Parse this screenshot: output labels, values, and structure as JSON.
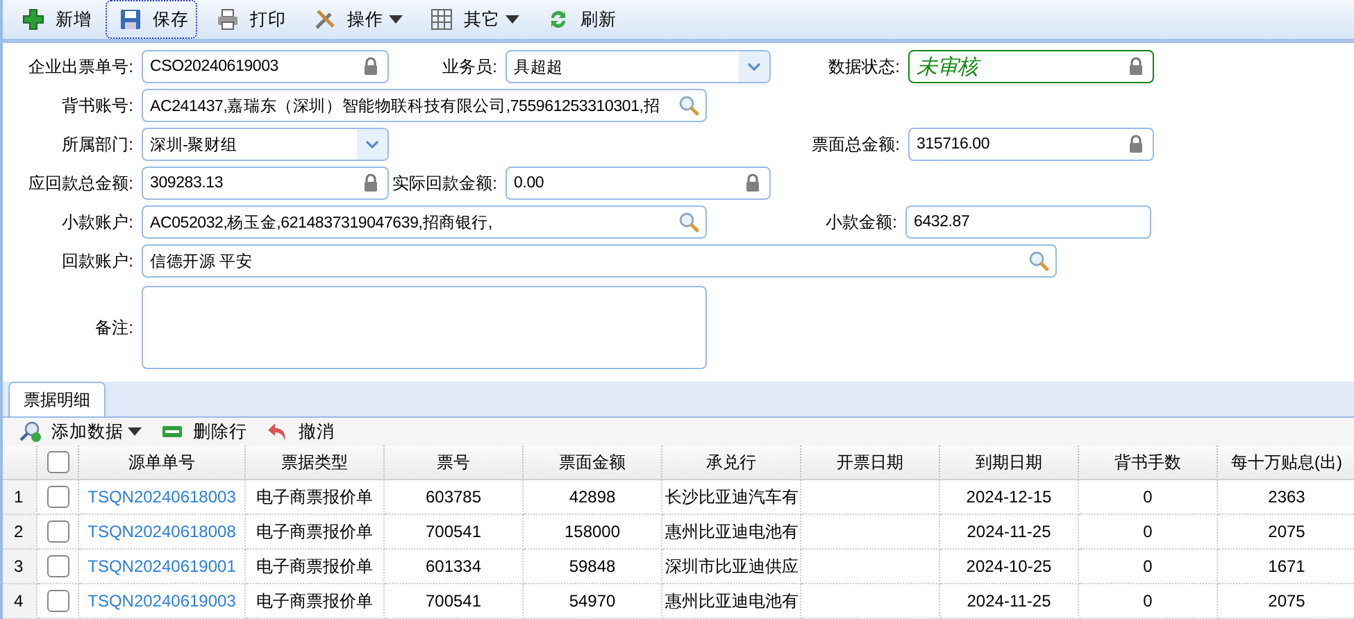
{
  "toolbar": [
    {
      "label": "新增",
      "focused": false,
      "dropdown": false
    },
    {
      "label": "保存",
      "focused": true,
      "dropdown": false
    },
    {
      "label": "打印",
      "focused": false,
      "dropdown": false
    },
    {
      "label": "操作",
      "focused": false,
      "dropdown": true
    },
    {
      "label": "其它",
      "focused": false,
      "dropdown": true
    },
    {
      "label": "刷新",
      "focused": false,
      "dropdown": false
    }
  ],
  "form": {
    "rows": [
      [
        {
          "label": "企业出票单号:",
          "value": "CSO20240619003",
          "kind": "locked"
        },
        {
          "label": "业务员:",
          "value": "具超超",
          "kind": "select"
        },
        {
          "label": "数据状态:",
          "value": "未审核",
          "kind": "status"
        }
      ],
      [
        {
          "label": "背书账号:",
          "value": "AC241437,嘉瑞东（深圳）智能物联科技有限公司,755961253310301,招",
          "kind": "lookup"
        }
      ],
      [
        {
          "label": "所属部门:",
          "value": "深圳-聚财组",
          "kind": "select"
        },
        {
          "label": "票面总金额:",
          "value": "315716.00",
          "kind": "locked"
        }
      ],
      [
        {
          "label": "应回款总金额:",
          "value": "309283.13",
          "kind": "locked"
        },
        {
          "label": "实际回款金额:",
          "value": "0.00",
          "kind": "locked"
        }
      ],
      [
        {
          "label": "小款账户:",
          "value": "AC052032,杨玉金,6214837319047639,招商银行,",
          "kind": "lookup"
        },
        {
          "label": "小款金额:",
          "value": "6432.87",
          "kind": "plain"
        }
      ],
      [
        {
          "label": "回款账户:",
          "value": "信德开源 平安",
          "kind": "lookup"
        }
      ],
      [
        {
          "label": "备注:",
          "kind": "textarea"
        }
      ]
    ]
  },
  "tabs": [
    {
      "label": "票据明细",
      "selected": true
    }
  ],
  "grid_toolbar": [
    {
      "label": "添加数据",
      "dropdown": true
    },
    {
      "label": "删除行",
      "dropdown": false
    },
    {
      "label": "撤消",
      "dropdown": false
    }
  ],
  "table": {
    "header_checked": false,
    "columns": [
      "源单单号",
      "票据类型",
      "票号",
      "票面金额",
      "承兑行",
      "开票日期",
      "到期日期",
      "背书手数",
      "每十万贴息(出)"
    ],
    "rows": [
      {
        "index": "1",
        "checked": false,
        "cells": [
          "TSQN20240618003",
          "电子商票报价单",
          "603785",
          "42898",
          "长沙比亚迪汽车有",
          "",
          "2024-12-15",
          "0",
          "2363"
        ]
      },
      {
        "index": "2",
        "checked": false,
        "cells": [
          "TSQN20240618008",
          "电子商票报价单",
          "700541",
          "158000",
          "惠州比亚迪电池有",
          "",
          "2024-11-25",
          "0",
          "2075"
        ]
      },
      {
        "index": "3",
        "checked": false,
        "cells": [
          "TSQN20240619001",
          "电子商票报价单",
          "601334",
          "59848",
          "深圳市比亚迪供应",
          "",
          "2024-10-25",
          "0",
          "1671"
        ]
      },
      {
        "index": "4",
        "checked": false,
        "cells": [
          "TSQN20240619003",
          "电子商票报价单",
          "700541",
          "54970",
          "惠州比亚迪电池有",
          "",
          "2024-11-25",
          "0",
          "2075"
        ]
      }
    ]
  }
}
